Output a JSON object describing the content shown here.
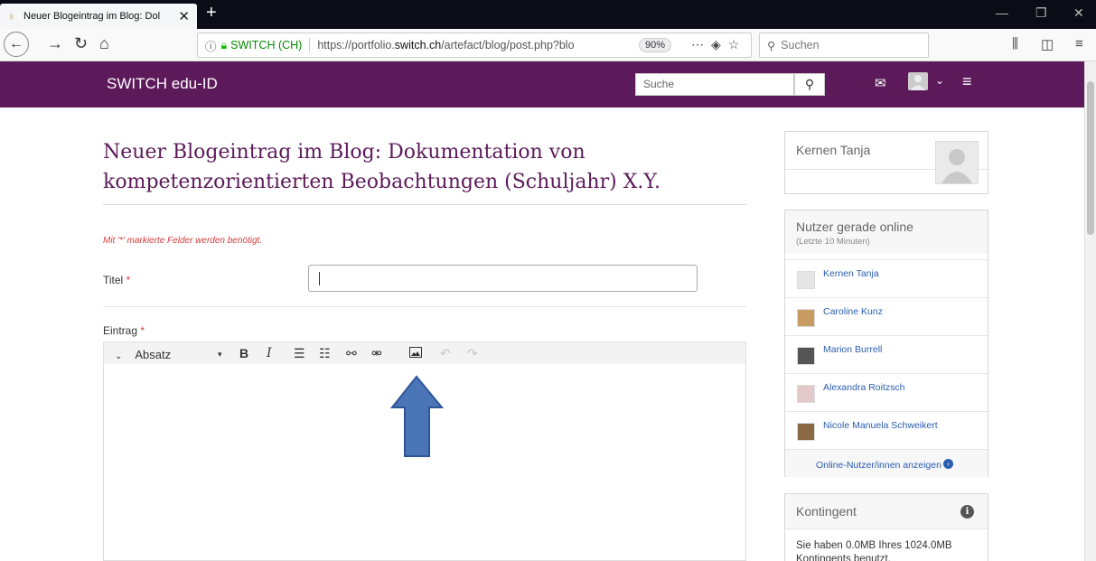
{
  "browser": {
    "tab_title": "Neuer Blogeintrag im Blog: Dol",
    "tab_close": "✕",
    "new_tab": "+",
    "site_identity": "SWITCH (CH)",
    "url_prefix": "https://portfolio.",
    "url_domain": "switch.ch",
    "url_path": "/artefact/blog/post.php?blo",
    "zoom": "90%",
    "search_placeholder": "Suchen"
  },
  "header": {
    "brand": "SWITCH edu-ID",
    "search_placeholder": "Suche"
  },
  "page": {
    "title": "Neuer Blogeintrag im Blog: Dokumentation von kompetenzorientierten Beobachtungen (Schuljahr) X.Y.",
    "required_note": "Mit '*' markierte Felder werden benötigt.",
    "title_label": "Titel",
    "entry_label": "Eintrag",
    "required_star": "*",
    "title_value": ""
  },
  "editor": {
    "format_select": "Absatz",
    "bold": "B",
    "italic": "I"
  },
  "sidebar": {
    "profile_name": "Kernen Tanja",
    "online_title": "Nutzer gerade online",
    "online_subtitle": "(Letzte 10 Minuten)",
    "online_users": [
      "Kernen Tanja",
      "Caroline Kunz",
      "Marion Burrell",
      "Alexandra Roitzsch",
      "Nicole Manuela Schweikert"
    ],
    "show_all_label": "Online-Nutzer/innen anzeigen",
    "quota_title": "Kontingent",
    "quota_text": "Sie haben 0.0MB Ihres 1024.0MB Kontingents benutzt."
  },
  "colors": {
    "header_bg": "#5c1a5a",
    "link": "#2a5db0",
    "required": "#d23b3b",
    "annotation_arrow": "#4a76b8"
  }
}
